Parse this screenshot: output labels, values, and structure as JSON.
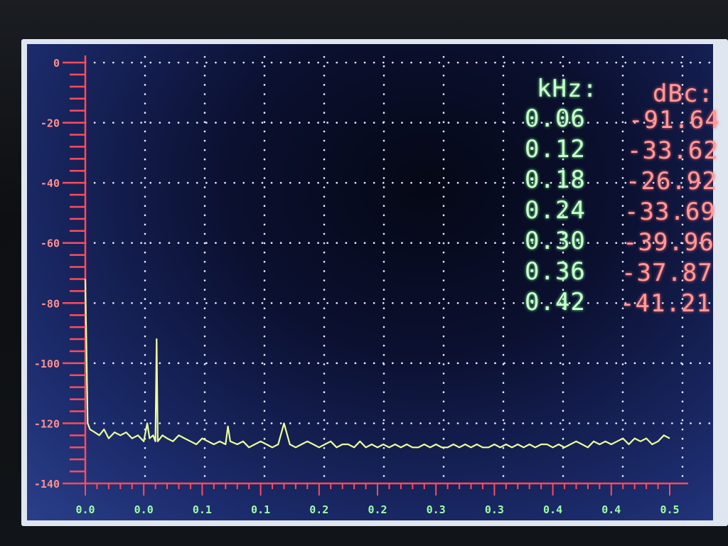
{
  "readout": {
    "freq_header": "kHz:",
    "level_header": "dBc:",
    "rows": [
      {
        "freq": "0.06",
        "level": "-91.64"
      },
      {
        "freq": "0.12",
        "level": "-33.62"
      },
      {
        "freq": "0.18",
        "level": "-26.92"
      },
      {
        "freq": "0.24",
        "level": "-33.69"
      },
      {
        "freq": "0.30",
        "level": "-39.96"
      },
      {
        "freq": "0.36",
        "level": "-37.87"
      },
      {
        "freq": "0.42",
        "level": "-41.21"
      }
    ]
  },
  "colors": {
    "trace": "#eeff99",
    "y_axis": "#ff4b5c",
    "x_axis": "#ff4b5c",
    "grid": "#e8ecff",
    "y_labels": "#ff8f8f",
    "x_labels": "#9dffa8"
  },
  "chart_data": {
    "type": "line",
    "title": "",
    "xlabel": "",
    "ylabel": "",
    "ylim": [
      -140,
      0
    ],
    "xlim": [
      0,
      0.5
    ],
    "y_ticks": [
      "0",
      "-20",
      "-40",
      "-60",
      "-80",
      "-100",
      "-120",
      "-140"
    ],
    "x_ticks": [
      "0.0",
      "0.0",
      "0.1",
      "0.1",
      "0.2",
      "0.2",
      "0.3",
      "0.3",
      "0.4",
      "0.4",
      "0.5"
    ],
    "grid": true,
    "series": [
      {
        "x": [
          0.0,
          0.002,
          0.004,
          0.008,
          0.012,
          0.016,
          0.02,
          0.025,
          0.03,
          0.035,
          0.04,
          0.045,
          0.05,
          0.053,
          0.055,
          0.058,
          0.06,
          0.061,
          0.062,
          0.064,
          0.066,
          0.07,
          0.075,
          0.08,
          0.085,
          0.09,
          0.095,
          0.1,
          0.105,
          0.11,
          0.115,
          0.12,
          0.122,
          0.124,
          0.13,
          0.135,
          0.14,
          0.145,
          0.15,
          0.155,
          0.16,
          0.165,
          0.17,
          0.175,
          0.18,
          0.185,
          0.19,
          0.195,
          0.2,
          0.205,
          0.21,
          0.215,
          0.22,
          0.225,
          0.23,
          0.235,
          0.24,
          0.245,
          0.25,
          0.255,
          0.26,
          0.265,
          0.27,
          0.275,
          0.28,
          0.285,
          0.29,
          0.295,
          0.3,
          0.305,
          0.31,
          0.315,
          0.32,
          0.325,
          0.33,
          0.335,
          0.34,
          0.345,
          0.35,
          0.355,
          0.36,
          0.365,
          0.37,
          0.375,
          0.38,
          0.385,
          0.39,
          0.395,
          0.4,
          0.405,
          0.41,
          0.415,
          0.42,
          0.425,
          0.43,
          0.435,
          0.44,
          0.445,
          0.45,
          0.455,
          0.46,
          0.465,
          0.47,
          0.475,
          0.48,
          0.485,
          0.49,
          0.495,
          0.5
        ],
        "y": [
          -72,
          -120,
          -122,
          -123,
          -124,
          -122,
          -125,
          -123,
          -124,
          -123,
          -125,
          -124,
          -126,
          -120,
          -125,
          -124,
          -126,
          -92,
          -126,
          -125,
          -124,
          -125,
          -126,
          -124,
          -125,
          -126,
          -127,
          -125,
          -126,
          -127,
          -126,
          -127,
          -121,
          -126,
          -127,
          -126,
          -128,
          -127,
          -126,
          -127,
          -128,
          -127,
          -120,
          -127,
          -128,
          -127,
          -126,
          -127,
          -128,
          -127,
          -126,
          -128,
          -127,
          -127,
          -128,
          -126,
          -128,
          -127,
          -128,
          -127,
          -128,
          -127,
          -128,
          -127,
          -128,
          -128,
          -127,
          -128,
          -127,
          -128,
          -128,
          -127,
          -128,
          -127,
          -128,
          -127,
          -128,
          -128,
          -127,
          -128,
          -127,
          -128,
          -127,
          -128,
          -127,
          -128,
          -127,
          -127,
          -128,
          -127,
          -128,
          -127,
          -126,
          -127,
          -128,
          -126,
          -127,
          -126,
          -127,
          -126,
          -125,
          -127,
          -125,
          -126,
          -125,
          -127,
          -126,
          -124,
          -125
        ]
      }
    ]
  }
}
